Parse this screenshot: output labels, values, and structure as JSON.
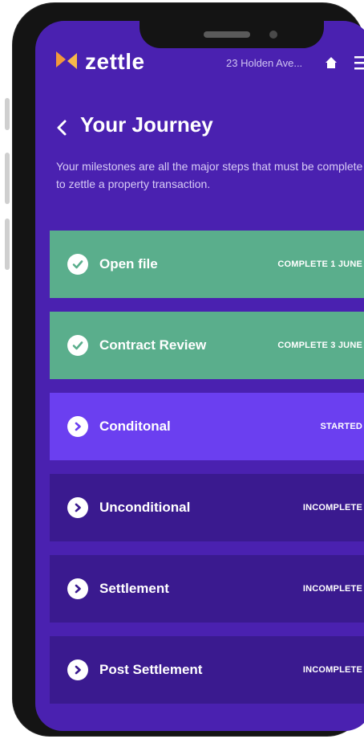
{
  "header": {
    "logo_text": "zettle",
    "address": "23 Holden Ave...",
    "brand_color": "#4a21b0",
    "logo_accent_color": "#f2993a"
  },
  "title": {
    "text": "Your Journey",
    "description": "Your milestones are all the major steps that must be complete to zettle a property transaction."
  },
  "milestones": [
    {
      "label": "Open file",
      "status": "COMPLETE 1 JUNE",
      "state": "complete",
      "icon": "check-icon"
    },
    {
      "label": "Contract Review",
      "status": "COMPLETE 3 JUNE",
      "state": "complete",
      "icon": "check-icon"
    },
    {
      "label": "Conditonal",
      "status": "STARTED",
      "state": "started",
      "icon": "chevron-right-icon"
    },
    {
      "label": "Unconditional",
      "status": "INCOMPLETE",
      "state": "incomplete",
      "icon": "chevron-right-icon"
    },
    {
      "label": "Settlement",
      "status": "INCOMPLETE",
      "state": "incomplete",
      "icon": "chevron-right-icon"
    },
    {
      "label": "Post Settlement",
      "status": "INCOMPLETE",
      "state": "incomplete",
      "icon": "chevron-right-icon"
    }
  ],
  "colors": {
    "complete": "#5aae8c",
    "started": "#6b3ff0",
    "incomplete": "#3a1a8f"
  }
}
